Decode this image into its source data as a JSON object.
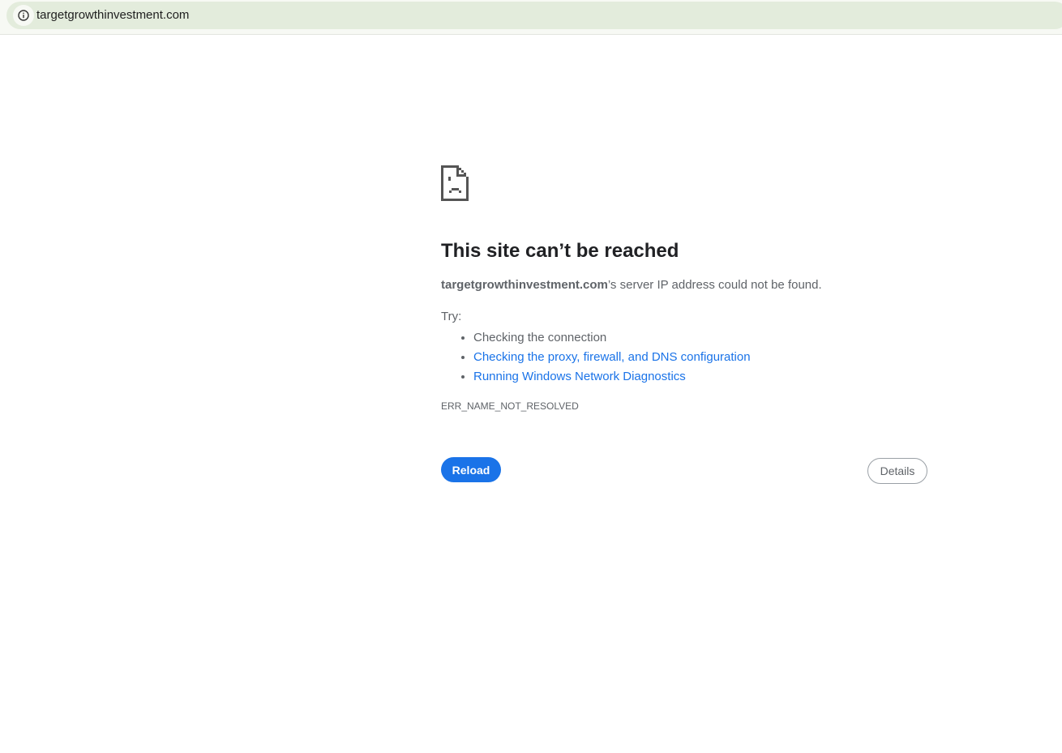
{
  "address_bar": {
    "url": "targetgrowthinvestment.com",
    "icon": "info-icon"
  },
  "error": {
    "icon": "sad-page-icon",
    "title": "This site can’t be reached",
    "domain": "targetgrowthinvestment.com",
    "message": "’s server IP address could not be found.",
    "try_label": "Try:",
    "suggestions": [
      "Checking the connection",
      "Checking the proxy, firewall, and DNS configuration",
      "Running Windows Network Diagnostics"
    ],
    "code": "ERR_NAME_NOT_RESOLVED"
  },
  "buttons": {
    "reload": "Reload",
    "details": "Details"
  }
}
